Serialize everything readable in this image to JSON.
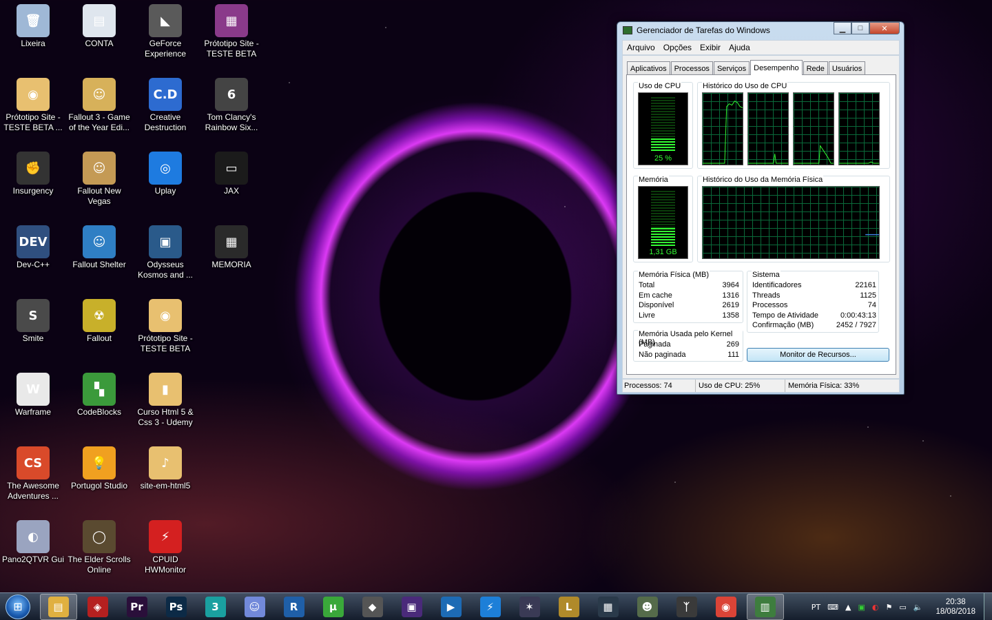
{
  "desktop": {
    "icons": [
      {
        "label": "Lixeira",
        "color": "#9fb8d6",
        "glyph": "🗑"
      },
      {
        "label": "CONTA",
        "color": "#dfe6ee",
        "glyph": "▤"
      },
      {
        "label": "GeForce Experience",
        "color": "#5a5a5a",
        "glyph": "◣"
      },
      {
        "label": "Prótotipo Site - TESTE BETA",
        "color": "#8a3a8a",
        "glyph": "▦"
      },
      {
        "label": "Prótotipo Site - TESTE BETA ...",
        "color": "#e8c070",
        "glyph": "◉"
      },
      {
        "label": "Fallout 3 - Game of the Year Edi...",
        "color": "#d7b15a",
        "glyph": "☺"
      },
      {
        "label": "Creative Destruction",
        "color": "#2d6bd0",
        "glyph": "C.D"
      },
      {
        "label": "Tom Clancy's Rainbow Six...",
        "color": "#444",
        "glyph": "6"
      },
      {
        "label": "Insurgency",
        "color": "#333",
        "glyph": "✊"
      },
      {
        "label": "Fallout New Vegas",
        "color": "#c49a55",
        "glyph": "☺"
      },
      {
        "label": "Uplay",
        "color": "#1e7be0",
        "glyph": "◎"
      },
      {
        "label": "JAX",
        "color": "#1b1b1b",
        "glyph": "▭"
      },
      {
        "label": "Dev-C++",
        "color": "#2f4f7f",
        "glyph": "DEV"
      },
      {
        "label": "Fallout Shelter",
        "color": "#2f7fc4",
        "glyph": "☺"
      },
      {
        "label": "Odysseus Kosmos and ...",
        "color": "#2a5a8a",
        "glyph": "▣"
      },
      {
        "label": "MEMORIA",
        "color": "#2a2a2a",
        "glyph": "▦"
      },
      {
        "label": "Smite",
        "color": "#4a4a4a",
        "glyph": "S"
      },
      {
        "label": "Fallout",
        "color": "#c8b02a",
        "glyph": "☢"
      },
      {
        "label": "Prótotipo Site - TESTE BETA",
        "color": "#e8c070",
        "glyph": "◉"
      },
      {
        "label": "",
        "color": "transparent",
        "glyph": ""
      },
      {
        "label": "Warframe",
        "color": "#e9e9e9",
        "glyph": "W"
      },
      {
        "label": "CodeBlocks",
        "color": "#3b9a3b",
        "glyph": "▚"
      },
      {
        "label": "Curso Html 5 & Css 3 - Udemy",
        "color": "#e8c070",
        "glyph": "▮"
      },
      {
        "label": "",
        "color": "transparent",
        "glyph": ""
      },
      {
        "label": "The Awesome Adventures ...",
        "color": "#d94a2a",
        "glyph": "CS"
      },
      {
        "label": "Portugol Studio",
        "color": "#f0a020",
        "glyph": "💡"
      },
      {
        "label": "site-em-html5",
        "color": "#e8c070",
        "glyph": "♪"
      },
      {
        "label": "",
        "color": "transparent",
        "glyph": ""
      },
      {
        "label": "Pano2QTVR Gui",
        "color": "#9aa4c0",
        "glyph": "◐"
      },
      {
        "label": "The Elder Scrolls Online",
        "color": "#5a4a30",
        "glyph": "◯"
      },
      {
        "label": "CPUID HWMonitor",
        "color": "#d42020",
        "glyph": "⚡"
      }
    ]
  },
  "taskmanager": {
    "title": "Gerenciador de Tarefas do Windows",
    "buttons": {
      "minimize": "▁",
      "maximize": "□",
      "close": "✕"
    },
    "menu": [
      "Arquivo",
      "Opções",
      "Exibir",
      "Ajuda"
    ],
    "tabs": [
      "Aplicativos",
      "Processos",
      "Serviços",
      "Desempenho",
      "Rede",
      "Usuários"
    ],
    "active_tab": "Desempenho",
    "cpu": {
      "title": "Uso de CPU",
      "value_label": "25 %",
      "level": 0.25
    },
    "cpu_history": {
      "title": "Histórico do Uso de CPU"
    },
    "memory": {
      "title": "Memória",
      "value_label": "1,31 GB",
      "level": 0.33
    },
    "memory_history": {
      "title": "Histórico do Uso da Memória Física"
    },
    "physical_memory": {
      "title": "Memória Física (MB)",
      "rows": [
        {
          "k": "Total",
          "v": "3964"
        },
        {
          "k": "Em cache",
          "v": "1316"
        },
        {
          "k": "Disponível",
          "v": "2619"
        },
        {
          "k": "Livre",
          "v": "1358"
        }
      ]
    },
    "kernel_memory": {
      "title": "Memória Usada pelo Kernel (MB)",
      "rows": [
        {
          "k": "Paginada",
          "v": "269"
        },
        {
          "k": "Não paginada",
          "v": "111"
        }
      ]
    },
    "system": {
      "title": "Sistema",
      "rows": [
        {
          "k": "Identificadores",
          "v": "22161"
        },
        {
          "k": "Threads",
          "v": "1125"
        },
        {
          "k": "Processos",
          "v": "74"
        },
        {
          "k": "Tempo de Atividade",
          "v": "0:00:43:13"
        },
        {
          "k": "Confirmação (MB)",
          "v": "2452 / 7927"
        }
      ]
    },
    "resource_monitor_button": "Monitor de Recursos...",
    "status": {
      "processes": "Processos: 74",
      "cpu": "Uso de CPU: 25%",
      "memory": "Memória Física: 33%"
    }
  },
  "taskbar": {
    "start_glyph": "⊞",
    "apps": [
      {
        "name": "explorer",
        "glyph": "▤",
        "color": "#e0b040",
        "active": true
      },
      {
        "name": "red-app",
        "glyph": "◈",
        "color": "#b52020",
        "active": false
      },
      {
        "name": "premiere",
        "glyph": "Pr",
        "color": "#2a0f3a",
        "active": false
      },
      {
        "name": "photoshop",
        "glyph": "Ps",
        "color": "#0c2a46",
        "active": false
      },
      {
        "name": "3dsmax",
        "glyph": "3",
        "color": "#1aa0a0",
        "active": false
      },
      {
        "name": "discord",
        "glyph": "☺",
        "color": "#7289da",
        "active": false
      },
      {
        "name": "r-app",
        "glyph": "R",
        "color": "#1f5fa8",
        "active": false
      },
      {
        "name": "utorrent",
        "glyph": "µ",
        "color": "#3aa83a",
        "active": false
      },
      {
        "name": "gamemaker",
        "glyph": "◆",
        "color": "#555",
        "active": false
      },
      {
        "name": "cpu-app",
        "glyph": "▣",
        "color": "#4a2a7a",
        "active": false
      },
      {
        "name": "media-app",
        "glyph": "▶",
        "color": "#1d6bb5",
        "active": false
      },
      {
        "name": "thunder-app",
        "glyph": "⚡",
        "color": "#1d7fd8",
        "active": false
      },
      {
        "name": "star-app",
        "glyph": "✶",
        "color": "#3a3a55",
        "active": false
      },
      {
        "name": "league",
        "glyph": "L",
        "color": "#b08a2a",
        "active": false
      },
      {
        "name": "halo-game",
        "glyph": "▦",
        "color": "#2a3a4a",
        "active": false
      },
      {
        "name": "soldier-game",
        "glyph": "☻",
        "color": "#556b4a",
        "active": false
      },
      {
        "name": "skyrim",
        "glyph": "ᛉ",
        "color": "#3a3a3a",
        "active": false
      },
      {
        "name": "chrome",
        "glyph": "◉",
        "color": "#db4437",
        "active": false
      },
      {
        "name": "taskmanager",
        "glyph": "▥",
        "color": "#3e7d3e",
        "active": true
      }
    ],
    "tray": {
      "lang": "PT",
      "time": "20:38",
      "date": "18/08/2018"
    }
  }
}
